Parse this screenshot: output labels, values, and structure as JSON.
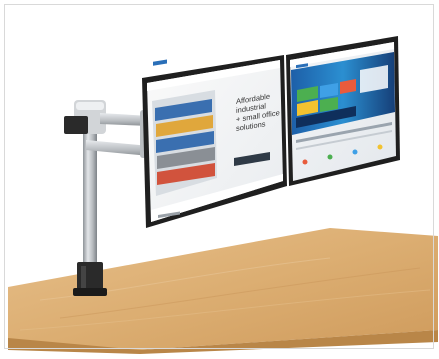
{
  "image": {
    "subject": "dual-monitor-arm-on-desk",
    "colors": {
      "background": "#ffffff",
      "desk": "#d9a66a",
      "desk_edge": "#b98648",
      "pole": "#bfc3c7",
      "clamp": "#2a2a2a",
      "bezel": "#1f1f1f",
      "accent_blue": "#2a6fb8"
    }
  },
  "left_screen": {
    "headline_lines": [
      "Affordable",
      "industrial",
      "+ small office",
      "solutions"
    ],
    "button_label": "",
    "footer_text": ""
  },
  "right_screen": {
    "banner_text": ""
  }
}
